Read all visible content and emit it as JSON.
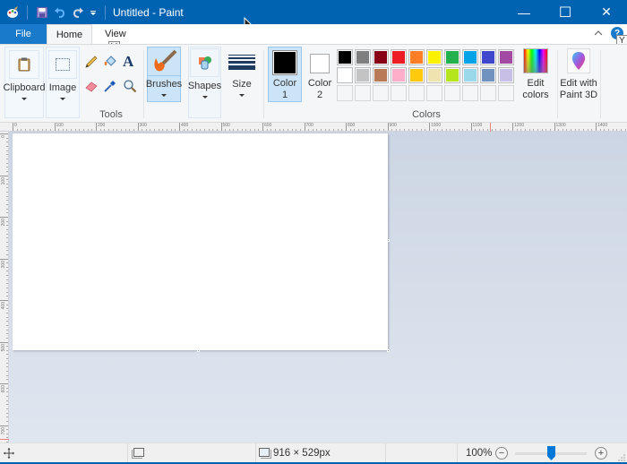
{
  "window": {
    "title": "Untitled - Paint",
    "controls": {
      "minimize": "—",
      "maximize": "☐",
      "close": "✕"
    }
  },
  "tabs": [
    {
      "label": "File"
    },
    {
      "label": "Home"
    },
    {
      "label": "View"
    }
  ],
  "keytips": {
    "view": "V",
    "help": "Y"
  },
  "ribbon": {
    "clipboard": {
      "label": "Clipboard"
    },
    "image": {
      "label": "Image"
    },
    "tools": {
      "label": "Tools"
    },
    "brushes": {
      "label": "Brushes"
    },
    "shapes": {
      "label": "Shapes"
    },
    "size": {
      "label": "Size"
    },
    "color1": {
      "label_line1": "Color",
      "label_line2": "1",
      "color": "#000000"
    },
    "color2": {
      "label_line1": "Color",
      "label_line2": "2",
      "color": "#ffffff"
    },
    "colors": {
      "label": "Colors",
      "row1": [
        "#000000",
        "#7f7f7f",
        "#880015",
        "#ed1c24",
        "#ff7f27",
        "#fff200",
        "#22b14c",
        "#00a2e8",
        "#3f48cc",
        "#a349a4"
      ],
      "row2": [
        "#ffffff",
        "#c3c3c3",
        "#b97a57",
        "#ffaec9",
        "#ffc90e",
        "#efe4b0",
        "#b5e61d",
        "#99d9ea",
        "#7092be",
        "#c8bfe7"
      ],
      "row3": [
        "",
        "",
        "",
        "",
        "",
        "",
        "",
        "",
        "",
        ""
      ]
    },
    "edit_colors": {
      "label_line1": "Edit",
      "label_line2": "colors"
    },
    "paint3d": {
      "label_line1": "Edit with",
      "label_line2": "Paint 3D"
    }
  },
  "ruler": {
    "horizontal": [
      "0",
      "100",
      "200",
      "300",
      "400",
      "500",
      "600",
      "700",
      "800",
      "900",
      "1000",
      "1100",
      "1200",
      "1300",
      "1400"
    ],
    "vertical": [
      "0",
      "100",
      "200",
      "300",
      "400",
      "500",
      "600",
      "700"
    ]
  },
  "status": {
    "image_size": "916 × 529px",
    "zoom": "100%",
    "zoom_out": "−",
    "zoom_in": "+",
    "zoom_level_percent": 100
  }
}
